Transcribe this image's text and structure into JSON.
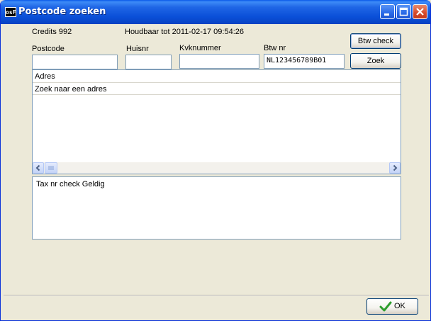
{
  "window": {
    "title": "Postcode zoeken",
    "app_icon_text": "osF"
  },
  "info": {
    "credits": "Credits 992",
    "expiry": "Houdbaar tot 2011-02-17 09:54:26"
  },
  "form": {
    "postcode_label": "Postcode",
    "postcode_value": "",
    "huisnr_label": "Huisnr",
    "huisnr_value": "",
    "kvk_label": "Kvknummer",
    "kvk_value": "",
    "btw_label": "Btw nr",
    "btw_value": "NL123456789B01"
  },
  "buttons": {
    "btw_check": "Btw check",
    "zoek": "Zoek",
    "ok": "OK"
  },
  "results": {
    "column_header": "Adres",
    "rows": [
      "Zoek naar een adres"
    ]
  },
  "memo": {
    "text": "Tax nr check Geldig"
  },
  "colors": {
    "titlebar": "#0a4fd8",
    "field_border": "#7f9db9",
    "button_border": "#003c74",
    "ok_check": "#2e9e2e"
  }
}
